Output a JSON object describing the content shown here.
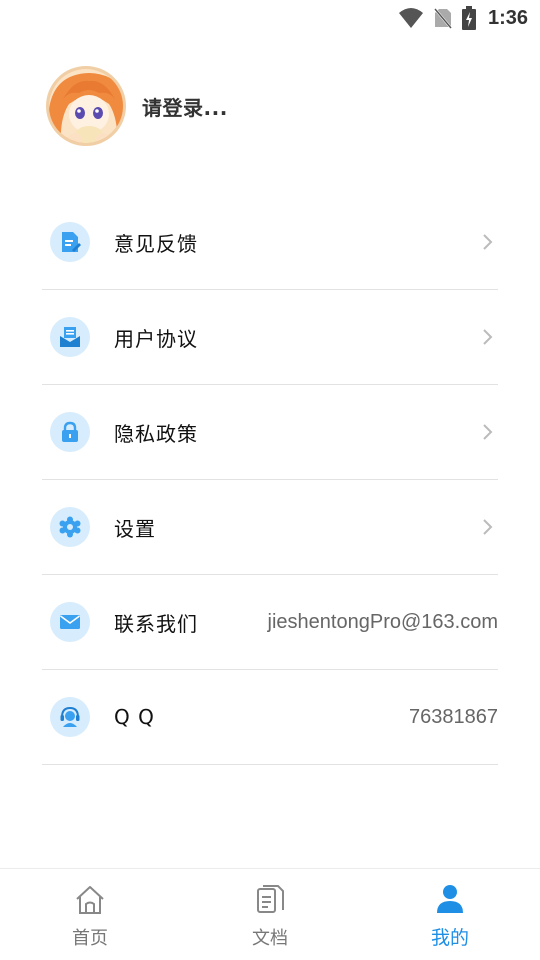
{
  "status_bar": {
    "time": "1:36",
    "icons": [
      "wifi-icon",
      "no-sim-icon",
      "battery-charging-icon"
    ]
  },
  "profile": {
    "name": "请登录...",
    "avatar": "anime-girl-avatar"
  },
  "menu": {
    "items": [
      {
        "label": "意见反馈",
        "icon": "feedback-document-icon",
        "value": "",
        "chevron": true
      },
      {
        "label": "用户协议",
        "icon": "user-agreement-icon",
        "value": "",
        "chevron": true
      },
      {
        "label": "隐私政策",
        "icon": "lock-icon",
        "value": "",
        "chevron": true
      },
      {
        "label": "设置",
        "icon": "gear-icon",
        "value": "",
        "chevron": true
      },
      {
        "label": "联系我们",
        "icon": "mail-icon",
        "value": "jieshentongPro@163.com",
        "chevron": false
      },
      {
        "label": "Q Q",
        "icon": "headset-support-icon",
        "value": "76381867",
        "chevron": false
      }
    ]
  },
  "bottom_nav": {
    "items": [
      {
        "label": "首页",
        "icon": "home-icon",
        "active": false
      },
      {
        "label": "文档",
        "icon": "documents-icon",
        "active": false
      },
      {
        "label": "我的",
        "icon": "person-icon",
        "active": true
      }
    ]
  },
  "colors": {
    "accent": "#1f8fe6",
    "icon_bg": "#d7ecfc",
    "icon_fg": "#3aa0f0",
    "divider": "#e2e2e2"
  }
}
